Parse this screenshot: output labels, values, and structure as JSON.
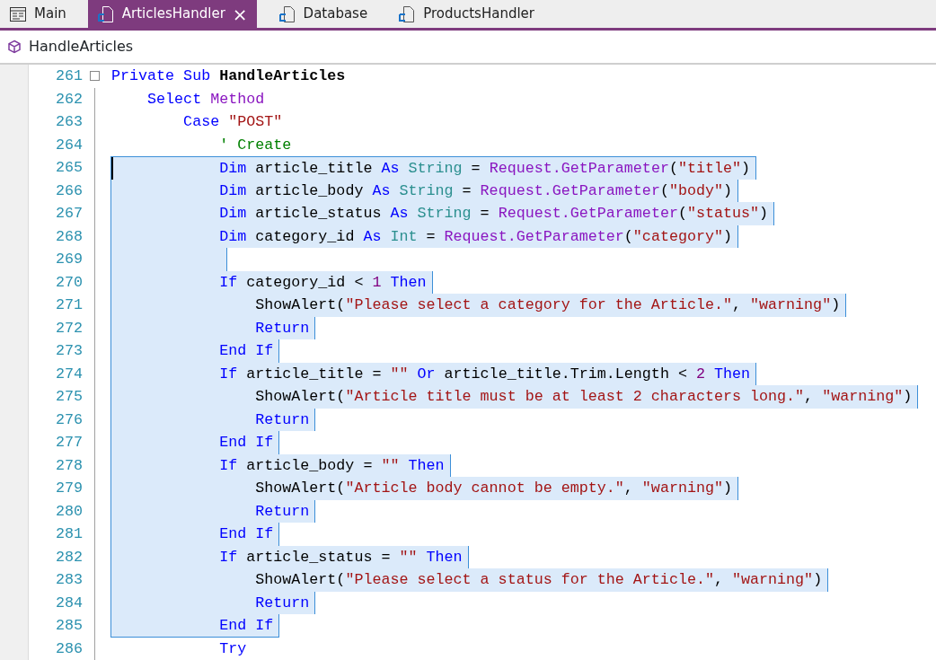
{
  "tabs": [
    {
      "label": "Main",
      "kind": "form",
      "selected": false,
      "closable": false
    },
    {
      "label": "ArticlesHandler",
      "kind": "module",
      "selected": true,
      "closable": true
    },
    {
      "label": "Database",
      "kind": "module",
      "selected": false,
      "closable": false
    },
    {
      "label": "ProductsHandler",
      "kind": "module",
      "selected": false,
      "closable": false
    }
  ],
  "close_glyph": "×",
  "breadcrumb": {
    "label": "HandleArticles"
  },
  "lines": [
    {
      "number": "261",
      "selected": false,
      "fold_start": true,
      "tokens": [
        {
          "kind": "kw",
          "text": "Private Sub "
        },
        {
          "kind": "bold",
          "text": "HandleArticles"
        }
      ]
    },
    {
      "number": "262",
      "selected": false,
      "tokens": [
        {
          "kind": "kw",
          "text": "    Select "
        },
        {
          "kind": "member",
          "text": "Method"
        }
      ]
    },
    {
      "number": "263",
      "selected": false,
      "tokens": [
        {
          "kind": "kw",
          "text": "        Case "
        },
        {
          "kind": "str",
          "text": "\"POST\""
        }
      ]
    },
    {
      "number": "264",
      "selected": false,
      "tokens": [
        {
          "kind": "comment",
          "text": "            ' Create"
        }
      ]
    },
    {
      "number": "265",
      "selected": true,
      "caret": true,
      "tokens": [
        {
          "kind": "kw",
          "text": "            Dim "
        },
        {
          "kind": "plain",
          "text": "article_title "
        },
        {
          "kind": "kw",
          "text": "As "
        },
        {
          "kind": "type",
          "text": "String "
        },
        {
          "kind": "plain",
          "text": "= "
        },
        {
          "kind": "member",
          "text": "Request.GetParameter"
        },
        {
          "kind": "plain",
          "text": "("
        },
        {
          "kind": "str",
          "text": "\"title\""
        },
        {
          "kind": "plain",
          "text": ")"
        }
      ]
    },
    {
      "number": "266",
      "selected": true,
      "tokens": [
        {
          "kind": "kw",
          "text": "            Dim "
        },
        {
          "kind": "plain",
          "text": "article_body "
        },
        {
          "kind": "kw",
          "text": "As "
        },
        {
          "kind": "type",
          "text": "String "
        },
        {
          "kind": "plain",
          "text": "= "
        },
        {
          "kind": "member",
          "text": "Request.GetParameter"
        },
        {
          "kind": "plain",
          "text": "("
        },
        {
          "kind": "str",
          "text": "\"body\""
        },
        {
          "kind": "plain",
          "text": ")"
        }
      ]
    },
    {
      "number": "267",
      "selected": true,
      "tokens": [
        {
          "kind": "kw",
          "text": "            Dim "
        },
        {
          "kind": "plain",
          "text": "article_status "
        },
        {
          "kind": "kw",
          "text": "As "
        },
        {
          "kind": "type",
          "text": "String "
        },
        {
          "kind": "plain",
          "text": "= "
        },
        {
          "kind": "member",
          "text": "Request.GetParameter"
        },
        {
          "kind": "plain",
          "text": "("
        },
        {
          "kind": "str",
          "text": "\"status\""
        },
        {
          "kind": "plain",
          "text": ")"
        }
      ]
    },
    {
      "number": "268",
      "selected": true,
      "tokens": [
        {
          "kind": "kw",
          "text": "            Dim "
        },
        {
          "kind": "plain",
          "text": "category_id "
        },
        {
          "kind": "kw",
          "text": "As "
        },
        {
          "kind": "type",
          "text": "Int "
        },
        {
          "kind": "plain",
          "text": "= "
        },
        {
          "kind": "member",
          "text": "Request.GetParameter"
        },
        {
          "kind": "plain",
          "text": "("
        },
        {
          "kind": "str",
          "text": "\"category\""
        },
        {
          "kind": "plain",
          "text": ")"
        }
      ]
    },
    {
      "number": "269",
      "selected": true
    },
    {
      "number": "270",
      "selected": true,
      "tokens": [
        {
          "kind": "kw",
          "text": "            If "
        },
        {
          "kind": "plain",
          "text": "category_id < "
        },
        {
          "kind": "num",
          "text": "1 "
        },
        {
          "kind": "kw",
          "text": "Then"
        }
      ]
    },
    {
      "number": "271",
      "selected": true,
      "tokens": [
        {
          "kind": "plain",
          "text": "                ShowAlert("
        },
        {
          "kind": "str",
          "text": "\"Please select a category for the Article.\""
        },
        {
          "kind": "plain",
          "text": ", "
        },
        {
          "kind": "str",
          "text": "\"warning\""
        },
        {
          "kind": "plain",
          "text": ")"
        }
      ]
    },
    {
      "number": "272",
      "selected": true,
      "tokens": [
        {
          "kind": "kw",
          "text": "                Return"
        }
      ]
    },
    {
      "number": "273",
      "selected": true,
      "tokens": [
        {
          "kind": "kw",
          "text": "            End If"
        }
      ]
    },
    {
      "number": "274",
      "selected": true,
      "tokens": [
        {
          "kind": "kw",
          "text": "            If "
        },
        {
          "kind": "plain",
          "text": "article_title = "
        },
        {
          "kind": "str",
          "text": "\"\""
        },
        {
          "kind": "kw",
          "text": " Or "
        },
        {
          "kind": "plain",
          "text": "article_title.Trim.Length < "
        },
        {
          "kind": "num",
          "text": "2 "
        },
        {
          "kind": "kw",
          "text": "Then"
        }
      ]
    },
    {
      "number": "275",
      "selected": true,
      "tokens": [
        {
          "kind": "plain",
          "text": "                ShowAlert("
        },
        {
          "kind": "str",
          "text": "\"Article title must be at least 2 characters long.\""
        },
        {
          "kind": "plain",
          "text": ", "
        },
        {
          "kind": "str",
          "text": "\"warning\""
        },
        {
          "kind": "plain",
          "text": ")"
        }
      ]
    },
    {
      "number": "276",
      "selected": true,
      "tokens": [
        {
          "kind": "kw",
          "text": "                Return"
        }
      ]
    },
    {
      "number": "277",
      "selected": true,
      "tokens": [
        {
          "kind": "kw",
          "text": "            End If"
        }
      ]
    },
    {
      "number": "278",
      "selected": true,
      "tokens": [
        {
          "kind": "kw",
          "text": "            If "
        },
        {
          "kind": "plain",
          "text": "article_body = "
        },
        {
          "kind": "str",
          "text": "\"\""
        },
        {
          "kind": "kw",
          "text": " Then"
        }
      ]
    },
    {
      "number": "279",
      "selected": true,
      "tokens": [
        {
          "kind": "plain",
          "text": "                ShowAlert("
        },
        {
          "kind": "str",
          "text": "\"Article body cannot be empty.\""
        },
        {
          "kind": "plain",
          "text": ", "
        },
        {
          "kind": "str",
          "text": "\"warning\""
        },
        {
          "kind": "plain",
          "text": ")"
        }
      ]
    },
    {
      "number": "280",
      "selected": true,
      "tokens": [
        {
          "kind": "kw",
          "text": "                Return"
        }
      ]
    },
    {
      "number": "281",
      "selected": true,
      "tokens": [
        {
          "kind": "kw",
          "text": "            End If"
        }
      ]
    },
    {
      "number": "282",
      "selected": true,
      "tokens": [
        {
          "kind": "kw",
          "text": "            If "
        },
        {
          "kind": "plain",
          "text": "article_status = "
        },
        {
          "kind": "str",
          "text": "\"\""
        },
        {
          "kind": "kw",
          "text": " Then"
        }
      ]
    },
    {
      "number": "283",
      "selected": true,
      "tokens": [
        {
          "kind": "plain",
          "text": "                ShowAlert("
        },
        {
          "kind": "str",
          "text": "\"Please select a status for the Article.\""
        },
        {
          "kind": "plain",
          "text": ", "
        },
        {
          "kind": "str",
          "text": "\"warning\""
        },
        {
          "kind": "plain",
          "text": ")"
        }
      ]
    },
    {
      "number": "284",
      "selected": true,
      "tokens": [
        {
          "kind": "kw",
          "text": "                Return"
        }
      ]
    },
    {
      "number": "285",
      "selected": true,
      "tokens": [
        {
          "kind": "kw",
          "text": "            End If"
        }
      ]
    },
    {
      "number": "286",
      "selected": false,
      "tokens": [
        {
          "kind": "kw",
          "text": "            Try"
        }
      ]
    }
  ]
}
